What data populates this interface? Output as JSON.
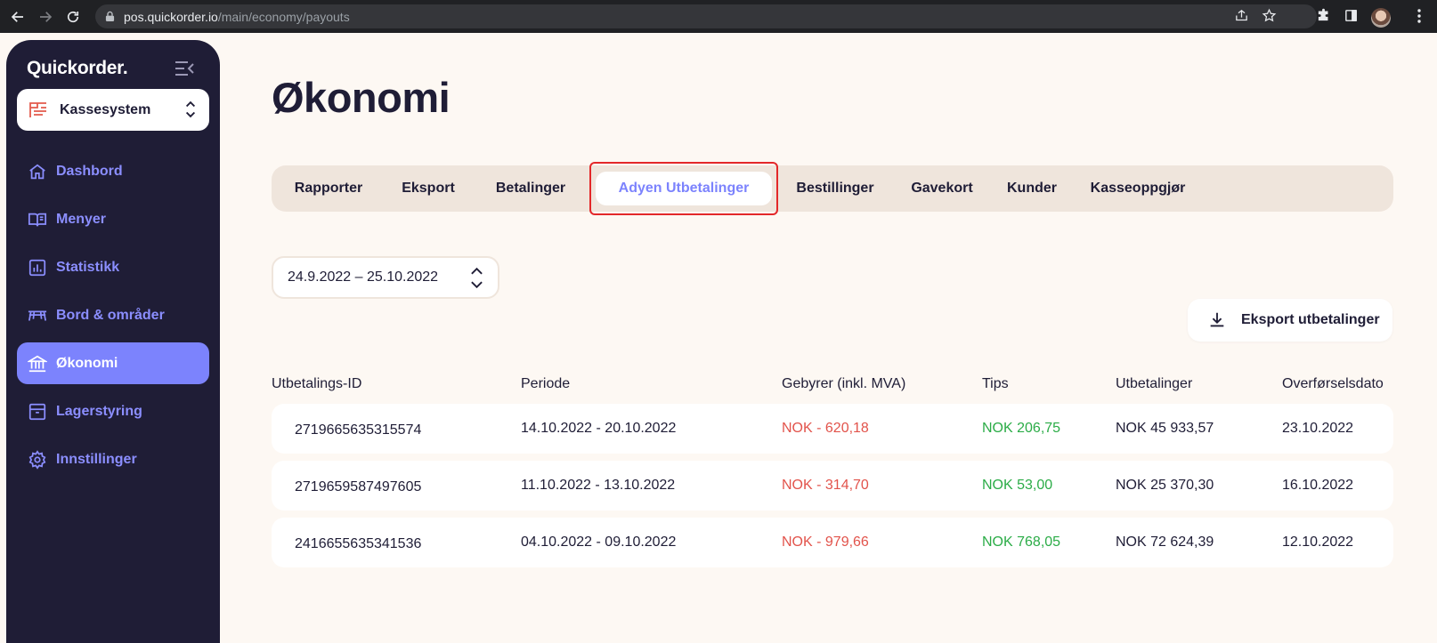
{
  "browser": {
    "url_host": "pos.quickorder.io",
    "url_path": "/main/economy/payouts"
  },
  "sidebar": {
    "logo": "Quickorder.",
    "venue": "Kassesystem",
    "items": [
      {
        "label": "Dashbord",
        "icon": "home-icon"
      },
      {
        "label": "Menyer",
        "icon": "book-icon"
      },
      {
        "label": "Statistikk",
        "icon": "chart-icon"
      },
      {
        "label": "Bord & områder",
        "icon": "table-icon"
      },
      {
        "label": "Økonomi",
        "icon": "bank-icon",
        "active": true
      },
      {
        "label": "Lagerstyring",
        "icon": "archive-icon"
      },
      {
        "label": "Innstillinger",
        "icon": "gear-icon"
      }
    ]
  },
  "main": {
    "title": "Økonomi",
    "tabs": [
      {
        "label": "Rapporter"
      },
      {
        "label": "Eksport"
      },
      {
        "label": "Betalinger"
      },
      {
        "label": "Adyen Utbetalinger",
        "active": true
      },
      {
        "label": "Bestillinger"
      },
      {
        "label": "Gavekort"
      },
      {
        "label": "Kunder"
      },
      {
        "label": "Kasseoppgjør"
      }
    ],
    "date_range": "24.9.2022 – 25.10.2022",
    "export_label": "Eksport utbetalinger",
    "table": {
      "headers": [
        "Utbetalings-ID",
        "Periode",
        "Gebyrer (inkl. MVA)",
        "Tips",
        "Utbetalinger",
        "Overførselsdato"
      ],
      "rows": [
        {
          "id": "2719665635315574",
          "period": "14.10.2022 - 20.10.2022",
          "fees": "NOK - 620,18",
          "tips": "NOK  206,75",
          "payout": "NOK  45 933,57",
          "date": "23.10.2022"
        },
        {
          "id": "2719659587497605",
          "period": "11.10.2022 - 13.10.2022",
          "fees": "NOK - 314,70",
          "tips": "NOK  53,00",
          "payout": "NOK  25 370,30",
          "date": "16.10.2022"
        },
        {
          "id": "2416655635341536",
          "period": "04.10.2022 - 09.10.2022",
          "fees": "NOK - 979,66",
          "tips": "NOK  768,05",
          "payout": "NOK  72 624,39",
          "date": "12.10.2022"
        }
      ]
    }
  },
  "colors": {
    "accent": "#7c83fd",
    "sidebar_bg": "#1f1d36",
    "fee_red": "#e2534b",
    "tip_green": "#2bac47",
    "highlight_red": "#e3282a"
  }
}
